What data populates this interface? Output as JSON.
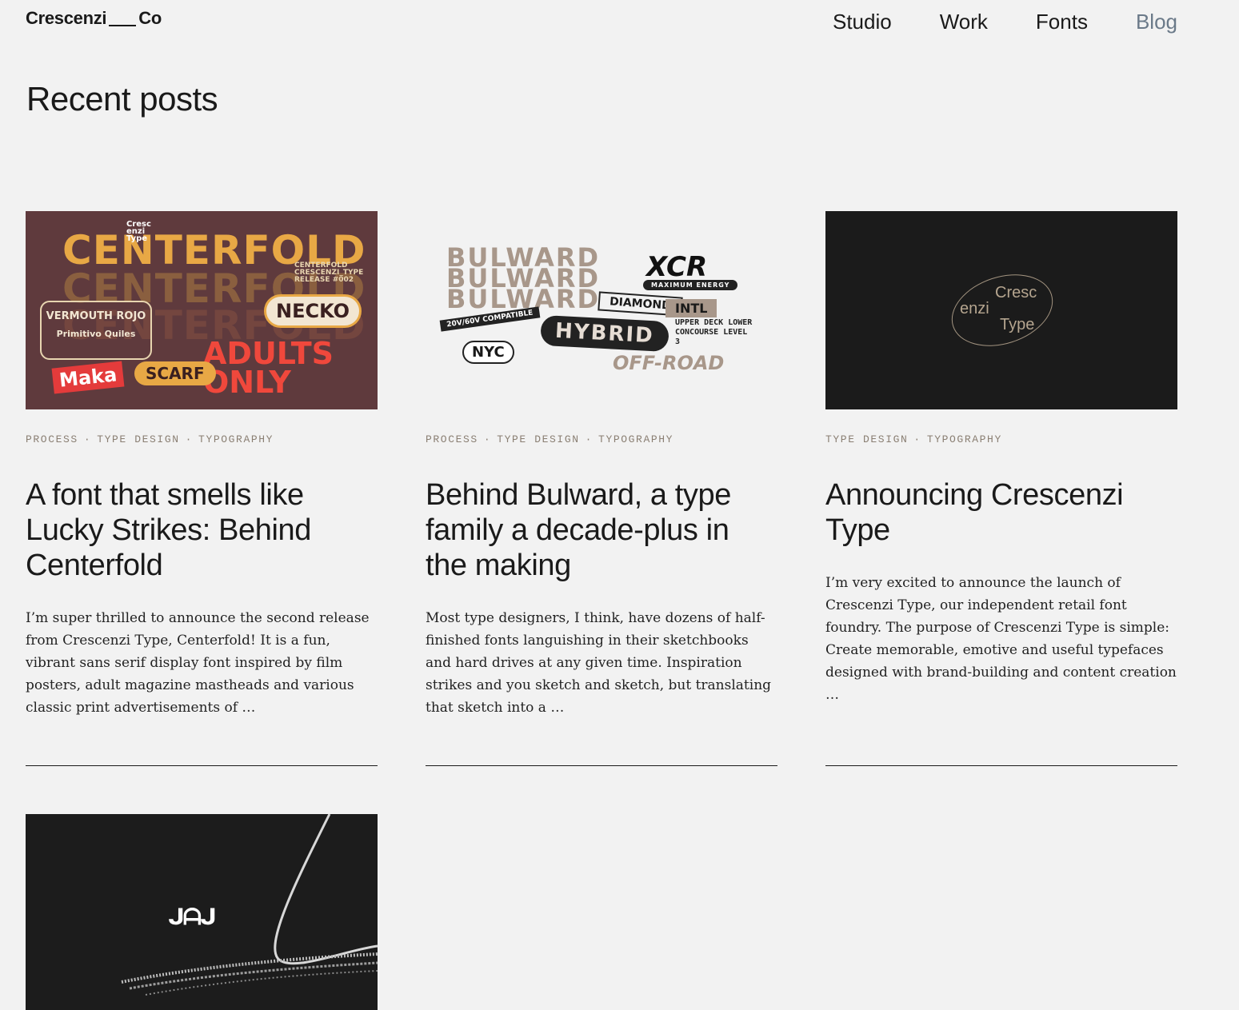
{
  "brand": {
    "name_left": "Crescenzi",
    "name_right": "Co"
  },
  "nav": [
    {
      "label": "Studio",
      "active": false
    },
    {
      "label": "Work",
      "active": false
    },
    {
      "label": "Fonts",
      "active": false
    },
    {
      "label": "Blog",
      "active": true
    }
  ],
  "page_title": "Recent posts",
  "posts": [
    {
      "tags": [
        "PROCESS",
        "TYPE DESIGN",
        "TYPOGRAPHY"
      ],
      "title": "A font that smells like Lucky Strikes: Behind Centerfold",
      "excerpt": "I’m super thrilled to announce the second release from Crescenzi Type, Centerfold! It is a fun, vibrant sans serif display font inspired by film posters, adult magazine mastheads and various classic print advertisements of …",
      "image": {
        "headline": "CENTERFOLD",
        "necko": "NECKO",
        "adults_only": "ADULTS ONLY",
        "scarf": "SCARF",
        "maka": "Maka",
        "vermouth": "VERMOUTH ROJO",
        "producer": "Primitivo Quiles",
        "logo_text": "Cresc enzi Type",
        "release": "CENTERFOLD CRESCENZI_TYPE RELEASE #002"
      }
    },
    {
      "tags": [
        "PROCESS",
        "TYPE DESIGN",
        "TYPOGRAPHY"
      ],
      "title": "Behind Bulward, a type family a decade-plus in the making",
      "excerpt": "Most type designers, I think, have dozens of half-finished fonts languishing in their sketchbooks and hard drives at any given time. Inspiration strikes and you sketch and sketch, but translating that sketch into a …",
      "image": {
        "bulward": "BULWARD",
        "xcr": "XCR",
        "energy": "MAXIMUM ENERGY",
        "hybrid": "HYBRID",
        "offroad": "OFF-ROAD",
        "nyc": "NYC",
        "diamond": "DIAMOND",
        "intl": "INTL",
        "concourse": "UPPER DECK LOWER CONCOURSE LEVEL 3",
        "compat": "20V/60V COMPATIBLE"
      }
    },
    {
      "tags": [
        "TYPE DESIGN",
        "TYPOGRAPHY"
      ],
      "title": "Announcing Crescenzi Type",
      "excerpt": "I’m very excited to announce the launch of Crescenzi Type, our independent retail font foundry. The purpose of Crescenzi Type is simple: Create memorable, emotive and useful typefaces designed with brand-building and content creation …",
      "image": {
        "logo_line1": "Cresc",
        "logo_line2": "enzi",
        "logo_line3": "Type"
      }
    },
    {
      "image": {
        "mark": "ᒍᗩᒍ"
      }
    }
  ],
  "colors": {
    "background": "#f2f2f2",
    "text": "#1a1a1a",
    "nav_active": "#6b7a89",
    "tags": "#8a7f73"
  }
}
